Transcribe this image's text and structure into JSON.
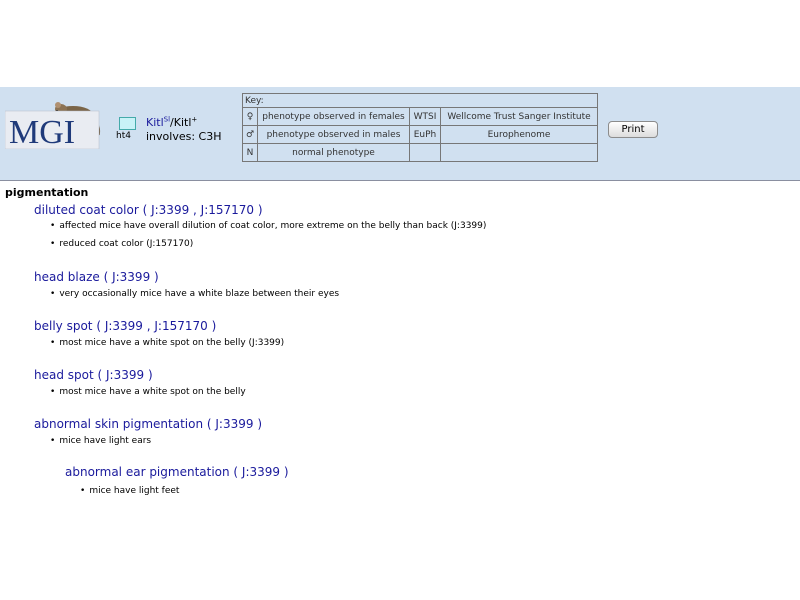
{
  "header": {
    "logo_text": "MGI",
    "ht_label": "ht4",
    "allele1_base": "Kitl",
    "allele1_sup": "Sl",
    "allele_sep": "/",
    "allele2_base": "Kitl",
    "allele2_sup": "+",
    "involves": "involves: C3H",
    "print_label": "Print"
  },
  "key": {
    "heading": "Key:",
    "rows": [
      {
        "symbol": "♀",
        "desc": "phenotype observed in females",
        "code": "WTSI",
        "source": "Wellcome Trust Sanger Institute"
      },
      {
        "symbol": "♂",
        "desc": "phenotype observed in males",
        "code": "EuPh",
        "source": "Europhenome"
      },
      {
        "symbol": "N",
        "desc": "normal phenotype",
        "code": "",
        "source": ""
      }
    ]
  },
  "content": {
    "section": "pigmentation",
    "terms": [
      {
        "term": "diluted coat color",
        "refs": [
          "J:3399",
          "J:157170"
        ],
        "notes": [
          "affected mice have overall dilution of coat color, more extreme on the belly than back (J:3399)",
          "reduced coat color (J:157170)"
        ]
      },
      {
        "term": "head blaze",
        "refs": [
          "J:3399"
        ],
        "notes": [
          "very occasionally mice have a white blaze between their eyes"
        ]
      },
      {
        "term": "belly spot",
        "refs": [
          "J:3399",
          "J:157170"
        ],
        "notes": [
          "most mice have a white spot on the belly (J:3399)"
        ]
      },
      {
        "term": "head spot",
        "refs": [
          "J:3399"
        ],
        "notes": [
          "most mice have a white spot on the belly"
        ]
      },
      {
        "term": "abnormal skin pigmentation",
        "refs": [
          "J:3399"
        ],
        "notes": [
          "mice have light ears"
        ]
      },
      {
        "term": "abnormal ear pigmentation",
        "refs": [
          "J:3399"
        ],
        "notes": [
          "mice have light feet"
        ]
      }
    ]
  }
}
